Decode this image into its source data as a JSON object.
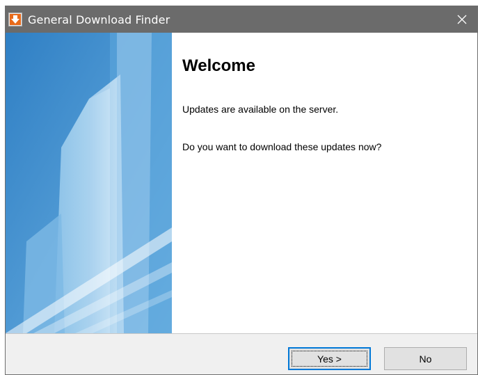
{
  "window": {
    "title": "General Download Finder",
    "icons": {
      "app": "download-arrow-icon",
      "close": "close-icon"
    }
  },
  "content": {
    "heading": "Welcome",
    "message1": "Updates are available on the server.",
    "message2": "Do you want to download these updates now?"
  },
  "buttons": {
    "yes": "Yes >",
    "no": "No"
  },
  "colors": {
    "titlebar": "#6b6b6b",
    "accent": "#0078d7",
    "side_panel": "#3d8fcf",
    "icon_orange": "#e86a1a"
  }
}
